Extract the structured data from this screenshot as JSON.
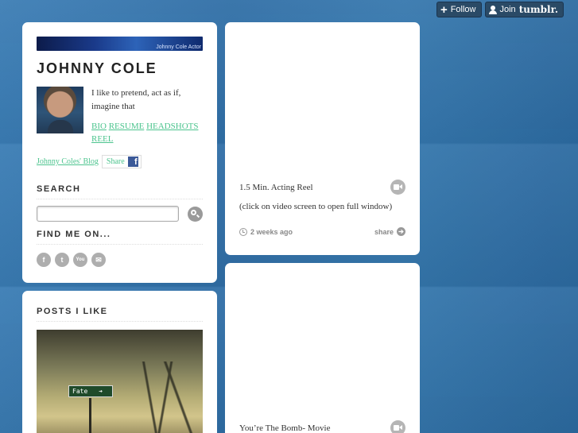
{
  "tumblr": {
    "follow_label": "Follow",
    "join_label": "Join",
    "brand": "tumblr."
  },
  "sidebar": {
    "banner_text": "Johnny Cole Actor",
    "title": "JOHNNY COLE",
    "description": "I like to pretend, act as if, imagine that",
    "links": [
      "BIO",
      "RESUME",
      "HEADSHOTS",
      "REEL"
    ],
    "blog_link": "Johnny Coles' Blog",
    "share_label": "Share",
    "search_heading": "SEARCH",
    "search_placeholder": "",
    "find_heading": "FIND ME ON...",
    "social": [
      {
        "icon": "facebook-icon",
        "glyph": "f"
      },
      {
        "icon": "twitter-icon",
        "glyph": "t"
      },
      {
        "icon": "youtube-icon",
        "glyph": "You"
      },
      {
        "icon": "email-icon",
        "glyph": "✉"
      }
    ]
  },
  "likes": {
    "heading": "POSTS I LIKE",
    "sign_text": "Fate",
    "sign_arrow": "➔"
  },
  "posts": [
    {
      "title": "1.5 Min. Acting Reel",
      "caption": "(click on video screen to open full window)",
      "time": "2 weeks ago",
      "share": "share"
    },
    {
      "title": "You’re The Bomb- Movie"
    }
  ],
  "colors": {
    "link": "#4cc48e",
    "background": "#2f6fa6"
  }
}
